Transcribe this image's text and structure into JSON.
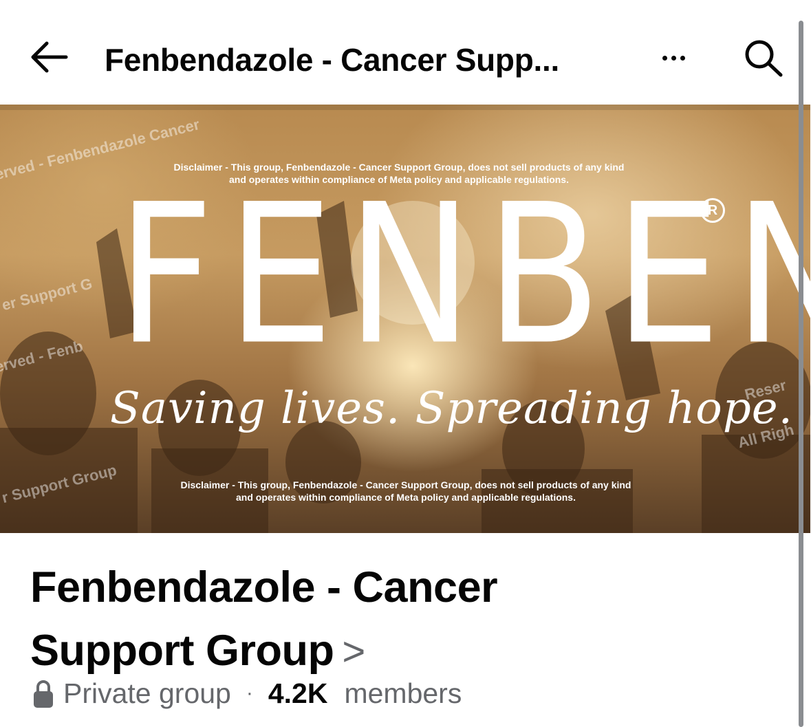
{
  "header": {
    "title": "Fenbendazole - Cancer Supp...",
    "back_icon": "arrow-left-icon",
    "more_icon": "more-horizontal-icon",
    "search_icon": "search-icon"
  },
  "cover": {
    "disclaimer_top_line1": "Disclaimer - This group, Fenbendazole - Cancer Support Group, does not sell products of any kind",
    "disclaimer_top_line2": "and operates within compliance of Meta policy and applicable regulations.",
    "brand": "FENBEN",
    "registered_mark": "R",
    "tagline": "Saving lives. Spreading hope.",
    "disclaimer_bottom_line1": "Disclaimer - This group, Fenbendazole - Cancer Support Group, does not sell products of any kind",
    "disclaimer_bottom_line2": "and operates within compliance of Meta policy and applicable regulations."
  },
  "group": {
    "name": "Fenbendazole - Cancer Support Group",
    "chevron": ">",
    "privacy": "Private group",
    "separator": "·",
    "member_count": "4.2K",
    "members_label": "members"
  },
  "colors": {
    "text_primary": "#050505",
    "text_secondary": "#65676b",
    "scrollbar": "#8a8d91"
  }
}
